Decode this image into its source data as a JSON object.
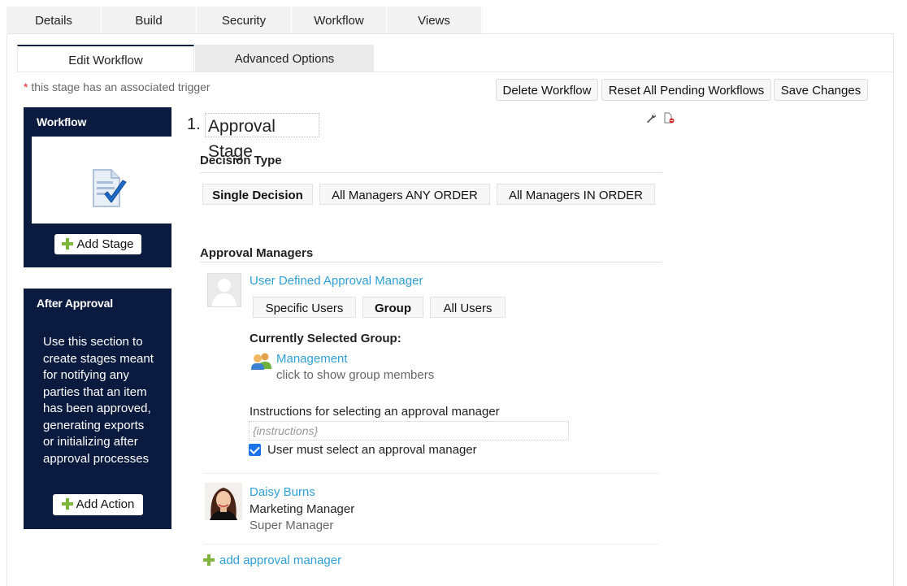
{
  "top_tabs": [
    "Details",
    "Build",
    "Security",
    "Workflow",
    "Views"
  ],
  "sub_tabs": {
    "edit": "Edit Workflow",
    "advanced": "Advanced Options"
  },
  "trigger_note": {
    "star": "*",
    "text": " this stage has an associated trigger"
  },
  "toolbar": {
    "delete": "Delete Workflow",
    "reset": "Reset All Pending Workflows",
    "save": "Save Changes"
  },
  "workflow_panel": {
    "title": "Workflow",
    "add_stage": "Add Stage"
  },
  "after_panel": {
    "title": "After Approval",
    "description": "Use this section to create stages meant for notifying any parties that an item has been approved, generating exports or initializing after approval processes",
    "add_action": "Add Action"
  },
  "stage": {
    "number": "1.",
    "name": "Approval Stage"
  },
  "decision": {
    "heading": "Decision Type",
    "options": [
      "Single Decision",
      "All Managers ANY ORDER",
      "All Managers IN ORDER"
    ],
    "selected": "Single Decision"
  },
  "managers": {
    "heading": "Approval Managers",
    "user_defined": {
      "title": "User Defined Approval Manager",
      "options": [
        "Specific Users",
        "Group",
        "All Users"
      ],
      "selected": "Group",
      "group_label": "Currently Selected Group:",
      "group_name": "Management",
      "group_hint": "click to show group members",
      "instructions_label": "Instructions for selecting an approval manager",
      "instructions_placeholder": "{instructions}",
      "must_select_label": "User must select an approval manager",
      "must_select_checked": true
    },
    "person": {
      "name": "Daisy Burns",
      "title": "Marketing Manager",
      "role": "Super Manager"
    },
    "add_link": "add approval manager"
  },
  "colors": {
    "panel": "#0b1a3f",
    "link": "#2e9fd6",
    "plus": "#7db63a",
    "checkbox": "#1a73e8"
  }
}
